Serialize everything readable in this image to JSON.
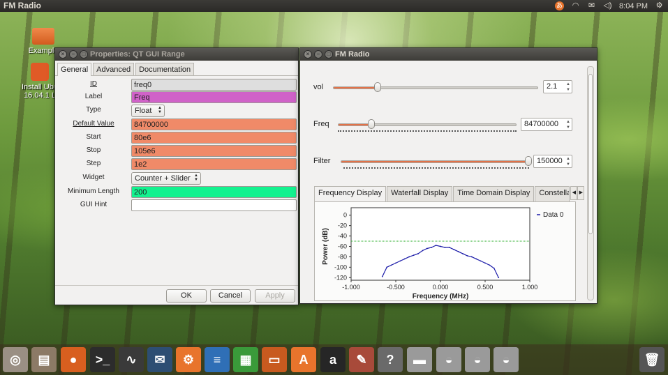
{
  "top_panel": {
    "app_title": "FM Radio",
    "clock": "8:04 PM",
    "icons": [
      "input-method-icon",
      "wifi-icon",
      "mail-icon",
      "volume-icon",
      "settings-icon"
    ]
  },
  "desktop": {
    "icons": [
      {
        "name": "examples-folder-icon",
        "label": "Example"
      },
      {
        "name": "install-ubuntu-icon",
        "label_line1": "Install Ubu",
        "label_line2": "16.04.1 L"
      }
    ]
  },
  "properties_dialog": {
    "title": "Properties: QT GUI Range",
    "tabs": [
      {
        "label": "General",
        "active": true
      },
      {
        "label": "Advanced",
        "active": false
      },
      {
        "label": "Documentation",
        "active": false
      }
    ],
    "rows": [
      {
        "label": "ID",
        "value": "freq0",
        "color": "#dedede",
        "underline": true
      },
      {
        "label": "Label",
        "value": "Freq",
        "color": "#d062c8"
      },
      {
        "label": "Type",
        "value": "Float",
        "combo": true
      },
      {
        "label": "Default Value",
        "value": "84700000",
        "color": "#f08a68",
        "underline": true
      },
      {
        "label": "Start",
        "value": "80e6",
        "color": "#f08a68"
      },
      {
        "label": "Stop",
        "value": "105e6",
        "color": "#f08a68"
      },
      {
        "label": "Step",
        "value": "1e2",
        "color": "#f08a68"
      },
      {
        "label": "Widget",
        "value": "Counter + Slider",
        "combo": true
      },
      {
        "label": "Minimum Length",
        "value": "200",
        "color": "#13f28f"
      },
      {
        "label": "GUI Hint",
        "value": "",
        "color": "#ffffff"
      }
    ],
    "buttons": {
      "ok": "OK",
      "cancel": "Cancel",
      "apply": "Apply"
    }
  },
  "fm_window": {
    "title": "FM Radio",
    "sliders": [
      {
        "label": "vol",
        "value": "2.1",
        "fraction": 0.22
      },
      {
        "label": "Freq",
        "value": "84700000",
        "fraction": 0.19
      },
      {
        "label": "Filter",
        "value": "150000",
        "fraction": 1.0
      }
    ],
    "tabs": [
      {
        "label": "Frequency Display",
        "active": true
      },
      {
        "label": "Waterfall Display",
        "active": false
      },
      {
        "label": "Time Domain Display",
        "active": false
      },
      {
        "label": "Constella",
        "active": false
      }
    ],
    "accent_color": "#e27249"
  },
  "chart_data": {
    "type": "line",
    "title": "",
    "xlabel": "Frequency (MHz)",
    "ylabel": "Power (dB)",
    "xlim": [
      -1.0,
      1.0
    ],
    "ylim": [
      -125,
      5
    ],
    "x_ticks": [
      "-1.000",
      "-0.500",
      "0.000",
      "0.500",
      "1.000"
    ],
    "y_ticks": [
      "0",
      "-20",
      "-40",
      "-60",
      "-80",
      "-100",
      "-120"
    ],
    "series": [
      {
        "name": "Data 0",
        "color": "#1a1aa8",
        "x": [
          -0.65,
          -0.6,
          -0.55,
          -0.5,
          -0.45,
          -0.4,
          -0.35,
          -0.3,
          -0.25,
          -0.2,
          -0.15,
          -0.1,
          -0.05,
          0.0,
          0.05,
          0.1,
          0.15,
          0.2,
          0.25,
          0.3,
          0.35,
          0.4,
          0.45,
          0.5,
          0.55,
          0.6,
          0.65
        ],
        "y": [
          -118,
          -100,
          -96,
          -92,
          -88,
          -84,
          -80,
          -77,
          -74,
          -68,
          -64,
          -62,
          -58,
          -60,
          -62,
          -62,
          -66,
          -70,
          -74,
          -78,
          -80,
          -84,
          -88,
          -92,
          -96,
          -102,
          -120
        ]
      }
    ],
    "threshold_line": {
      "y": -50,
      "color": "#1faa1f"
    },
    "legend": "top-right"
  },
  "dock": {
    "icons": [
      {
        "name": "ubuntu-dash-icon",
        "glyph": "◎",
        "color": "#9a8f84"
      },
      {
        "name": "files-icon",
        "glyph": "▤",
        "color": "#8c7a66"
      },
      {
        "name": "firefox-icon",
        "glyph": "●",
        "color": "#d85f1f"
      },
      {
        "name": "terminal-icon",
        "glyph": ">_",
        "color": "#2c2c2c"
      },
      {
        "name": "system-monitor-icon",
        "glyph": "∿",
        "color": "#3a3a3a"
      },
      {
        "name": "gnuradio-companion-icon",
        "glyph": "✉",
        "color": "#2d4e73"
      },
      {
        "name": "gnuradio-icon",
        "glyph": "⚙",
        "color": "#e8742c"
      },
      {
        "name": "libreoffice-writer-icon",
        "glyph": "≡",
        "color": "#2f6fb6"
      },
      {
        "name": "libreoffice-calc-icon",
        "glyph": "▦",
        "color": "#3a9a3a"
      },
      {
        "name": "libreoffice-impress-icon",
        "glyph": "▭",
        "color": "#c85a1f"
      },
      {
        "name": "software-center-icon",
        "glyph": "A",
        "color": "#e8742c"
      },
      {
        "name": "amazon-icon",
        "glyph": "a",
        "color": "#262626"
      },
      {
        "name": "system-settings-icon",
        "glyph": "✎",
        "color": "#a84a3a"
      },
      {
        "name": "help-icon",
        "glyph": "?",
        "color": "#6a6a6a"
      },
      {
        "name": "drive-1-icon",
        "glyph": "▬",
        "color": "#9a9a9a"
      },
      {
        "name": "drive-2-icon",
        "glyph": "◒",
        "color": "#9a9a9a"
      },
      {
        "name": "drive-3-icon",
        "glyph": "◒",
        "color": "#9a9a9a"
      },
      {
        "name": "drive-4-icon",
        "glyph": "◒",
        "color": "#9a9a9a"
      },
      {
        "name": "trash-icon",
        "glyph": "🗑",
        "color": "#555"
      }
    ]
  }
}
